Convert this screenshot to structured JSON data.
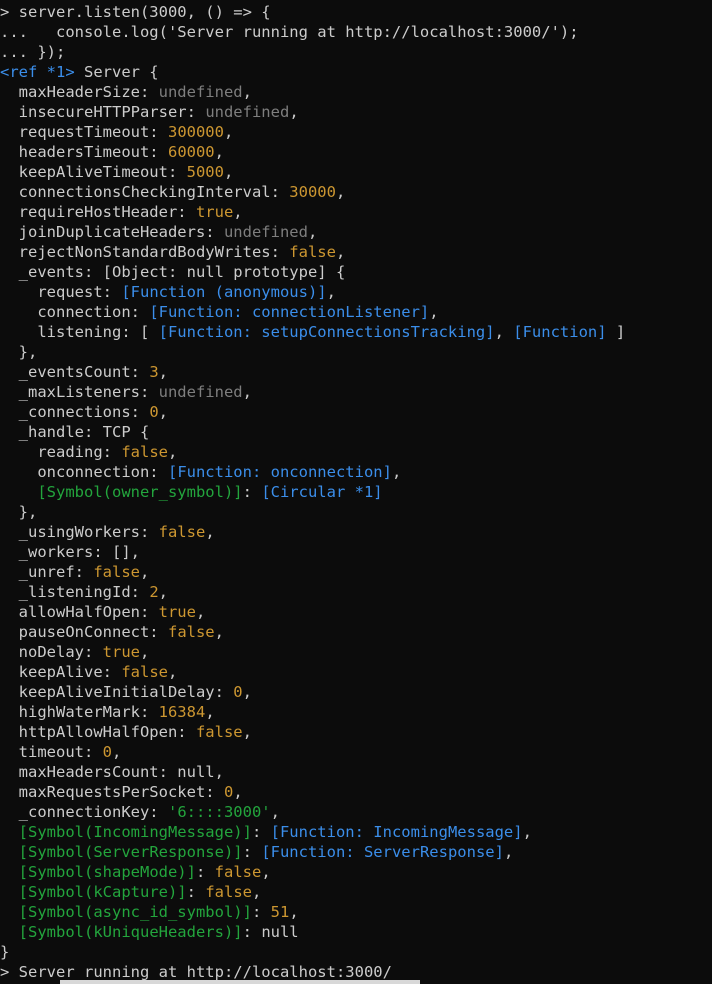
{
  "terminal": {
    "title": "node-repl",
    "background_color": "#0c0c0c",
    "foreground_color": "#cccccc",
    "prompt_symbol": "> ",
    "continuation_symbol": "... ",
    "colors": {
      "default": "#cccccc",
      "dim": "#7e7e7e",
      "blue": "#3b8eea",
      "yellow": "#cd9731",
      "green": "#23a53d",
      "white": "#e5e5e5"
    },
    "lines": [
      [
        {
          "t": "> server.listen(3000, () => {",
          "c": "default"
        }
      ],
      [
        {
          "t": "...   console.log('Server running at http://localhost:3000/');",
          "c": "default"
        }
      ],
      [
        {
          "t": "... });",
          "c": "default"
        }
      ],
      [
        {
          "t": "<ref *1>",
          "c": "blue"
        },
        {
          "t": " Server {",
          "c": "default"
        }
      ],
      [
        {
          "t": "  maxHeaderSize: ",
          "c": "default"
        },
        {
          "t": "undefined",
          "c": "dim"
        },
        {
          "t": ",",
          "c": "default"
        }
      ],
      [
        {
          "t": "  insecureHTTPParser: ",
          "c": "default"
        },
        {
          "t": "undefined",
          "c": "dim"
        },
        {
          "t": ",",
          "c": "default"
        }
      ],
      [
        {
          "t": "  requestTimeout: ",
          "c": "default"
        },
        {
          "t": "300000",
          "c": "yellow"
        },
        {
          "t": ",",
          "c": "default"
        }
      ],
      [
        {
          "t": "  headersTimeout: ",
          "c": "default"
        },
        {
          "t": "60000",
          "c": "yellow"
        },
        {
          "t": ",",
          "c": "default"
        }
      ],
      [
        {
          "t": "  keepAliveTimeout: ",
          "c": "default"
        },
        {
          "t": "5000",
          "c": "yellow"
        },
        {
          "t": ",",
          "c": "default"
        }
      ],
      [
        {
          "t": "  connectionsCheckingInterval: ",
          "c": "default"
        },
        {
          "t": "30000",
          "c": "yellow"
        },
        {
          "t": ",",
          "c": "default"
        }
      ],
      [
        {
          "t": "  requireHostHeader: ",
          "c": "default"
        },
        {
          "t": "true",
          "c": "yellow"
        },
        {
          "t": ",",
          "c": "default"
        }
      ],
      [
        {
          "t": "  joinDuplicateHeaders: ",
          "c": "default"
        },
        {
          "t": "undefined",
          "c": "dim"
        },
        {
          "t": ",",
          "c": "default"
        }
      ],
      [
        {
          "t": "  rejectNonStandardBodyWrites: ",
          "c": "default"
        },
        {
          "t": "false",
          "c": "yellow"
        },
        {
          "t": ",",
          "c": "default"
        }
      ],
      [
        {
          "t": "  _events: [Object: null prototype] {",
          "c": "default"
        }
      ],
      [
        {
          "t": "    request: ",
          "c": "default"
        },
        {
          "t": "[Function (anonymous)]",
          "c": "blue"
        },
        {
          "t": ",",
          "c": "default"
        }
      ],
      [
        {
          "t": "    connection: ",
          "c": "default"
        },
        {
          "t": "[Function: connectionListener]",
          "c": "blue"
        },
        {
          "t": ",",
          "c": "default"
        }
      ],
      [
        {
          "t": "    listening: [ ",
          "c": "default"
        },
        {
          "t": "[Function: setupConnectionsTracking]",
          "c": "blue"
        },
        {
          "t": ", ",
          "c": "default"
        },
        {
          "t": "[Function]",
          "c": "blue"
        },
        {
          "t": " ]",
          "c": "default"
        }
      ],
      [
        {
          "t": "  },",
          "c": "default"
        }
      ],
      [
        {
          "t": "  _eventsCount: ",
          "c": "default"
        },
        {
          "t": "3",
          "c": "yellow"
        },
        {
          "t": ",",
          "c": "default"
        }
      ],
      [
        {
          "t": "  _maxListeners: ",
          "c": "default"
        },
        {
          "t": "undefined",
          "c": "dim"
        },
        {
          "t": ",",
          "c": "default"
        }
      ],
      [
        {
          "t": "  _connections: ",
          "c": "default"
        },
        {
          "t": "0",
          "c": "yellow"
        },
        {
          "t": ",",
          "c": "default"
        }
      ],
      [
        {
          "t": "  _handle: TCP {",
          "c": "default"
        }
      ],
      [
        {
          "t": "    reading: ",
          "c": "default"
        },
        {
          "t": "false",
          "c": "yellow"
        },
        {
          "t": ",",
          "c": "default"
        }
      ],
      [
        {
          "t": "    onconnection: ",
          "c": "default"
        },
        {
          "t": "[Function: onconnection]",
          "c": "blue"
        },
        {
          "t": ",",
          "c": "default"
        }
      ],
      [
        {
          "t": "    ",
          "c": "default"
        },
        {
          "t": "[Symbol(owner_symbol)]",
          "c": "green"
        },
        {
          "t": ": ",
          "c": "default"
        },
        {
          "t": "[Circular *1]",
          "c": "blue"
        }
      ],
      [
        {
          "t": "  },",
          "c": "default"
        }
      ],
      [
        {
          "t": "  _usingWorkers: ",
          "c": "default"
        },
        {
          "t": "false",
          "c": "yellow"
        },
        {
          "t": ",",
          "c": "default"
        }
      ],
      [
        {
          "t": "  _workers: [],",
          "c": "default"
        }
      ],
      [
        {
          "t": "  _unref: ",
          "c": "default"
        },
        {
          "t": "false",
          "c": "yellow"
        },
        {
          "t": ",",
          "c": "default"
        }
      ],
      [
        {
          "t": "  _listeningId: ",
          "c": "default"
        },
        {
          "t": "2",
          "c": "yellow"
        },
        {
          "t": ",",
          "c": "default"
        }
      ],
      [
        {
          "t": "  allowHalfOpen: ",
          "c": "default"
        },
        {
          "t": "true",
          "c": "yellow"
        },
        {
          "t": ",",
          "c": "default"
        }
      ],
      [
        {
          "t": "  pauseOnConnect: ",
          "c": "default"
        },
        {
          "t": "false",
          "c": "yellow"
        },
        {
          "t": ",",
          "c": "default"
        }
      ],
      [
        {
          "t": "  noDelay: ",
          "c": "default"
        },
        {
          "t": "true",
          "c": "yellow"
        },
        {
          "t": ",",
          "c": "default"
        }
      ],
      [
        {
          "t": "  keepAlive: ",
          "c": "default"
        },
        {
          "t": "false",
          "c": "yellow"
        },
        {
          "t": ",",
          "c": "default"
        }
      ],
      [
        {
          "t": "  keepAliveInitialDelay: ",
          "c": "default"
        },
        {
          "t": "0",
          "c": "yellow"
        },
        {
          "t": ",",
          "c": "default"
        }
      ],
      [
        {
          "t": "  highWaterMark: ",
          "c": "default"
        },
        {
          "t": "16384",
          "c": "yellow"
        },
        {
          "t": ",",
          "c": "default"
        }
      ],
      [
        {
          "t": "  httpAllowHalfOpen: ",
          "c": "default"
        },
        {
          "t": "false",
          "c": "yellow"
        },
        {
          "t": ",",
          "c": "default"
        }
      ],
      [
        {
          "t": "  timeout: ",
          "c": "default"
        },
        {
          "t": "0",
          "c": "yellow"
        },
        {
          "t": ",",
          "c": "default"
        }
      ],
      [
        {
          "t": "  maxHeadersCount: null,",
          "c": "default"
        }
      ],
      [
        {
          "t": "  maxRequestsPerSocket: ",
          "c": "default"
        },
        {
          "t": "0",
          "c": "yellow"
        },
        {
          "t": ",",
          "c": "default"
        }
      ],
      [
        {
          "t": "  _connectionKey: ",
          "c": "default"
        },
        {
          "t": "'6::::3000'",
          "c": "green"
        },
        {
          "t": ",",
          "c": "default"
        }
      ],
      [
        {
          "t": "  ",
          "c": "default"
        },
        {
          "t": "[Symbol(IncomingMessage)]",
          "c": "green"
        },
        {
          "t": ": ",
          "c": "default"
        },
        {
          "t": "[Function: IncomingMessage]",
          "c": "blue"
        },
        {
          "t": ",",
          "c": "default"
        }
      ],
      [
        {
          "t": "  ",
          "c": "default"
        },
        {
          "t": "[Symbol(ServerResponse)]",
          "c": "green"
        },
        {
          "t": ": ",
          "c": "default"
        },
        {
          "t": "[Function: ServerResponse]",
          "c": "blue"
        },
        {
          "t": ",",
          "c": "default"
        }
      ],
      [
        {
          "t": "  ",
          "c": "default"
        },
        {
          "t": "[Symbol(shapeMode)]",
          "c": "green"
        },
        {
          "t": ": ",
          "c": "default"
        },
        {
          "t": "false",
          "c": "yellow"
        },
        {
          "t": ",",
          "c": "default"
        }
      ],
      [
        {
          "t": "  ",
          "c": "default"
        },
        {
          "t": "[Symbol(kCapture)]",
          "c": "green"
        },
        {
          "t": ": ",
          "c": "default"
        },
        {
          "t": "false",
          "c": "yellow"
        },
        {
          "t": ",",
          "c": "default"
        }
      ],
      [
        {
          "t": "  ",
          "c": "default"
        },
        {
          "t": "[Symbol(async_id_symbol)]",
          "c": "green"
        },
        {
          "t": ": ",
          "c": "default"
        },
        {
          "t": "51",
          "c": "yellow"
        },
        {
          "t": ",",
          "c": "default"
        }
      ],
      [
        {
          "t": "  ",
          "c": "default"
        },
        {
          "t": "[Symbol(kUniqueHeaders)]",
          "c": "green"
        },
        {
          "t": ": ",
          "c": "default"
        },
        {
          "t": "null",
          "c": "default"
        }
      ],
      [
        {
          "t": "}",
          "c": "default"
        }
      ],
      [
        {
          "t": "> Server running at http://localhost:3000/",
          "c": "default"
        }
      ]
    ]
  }
}
